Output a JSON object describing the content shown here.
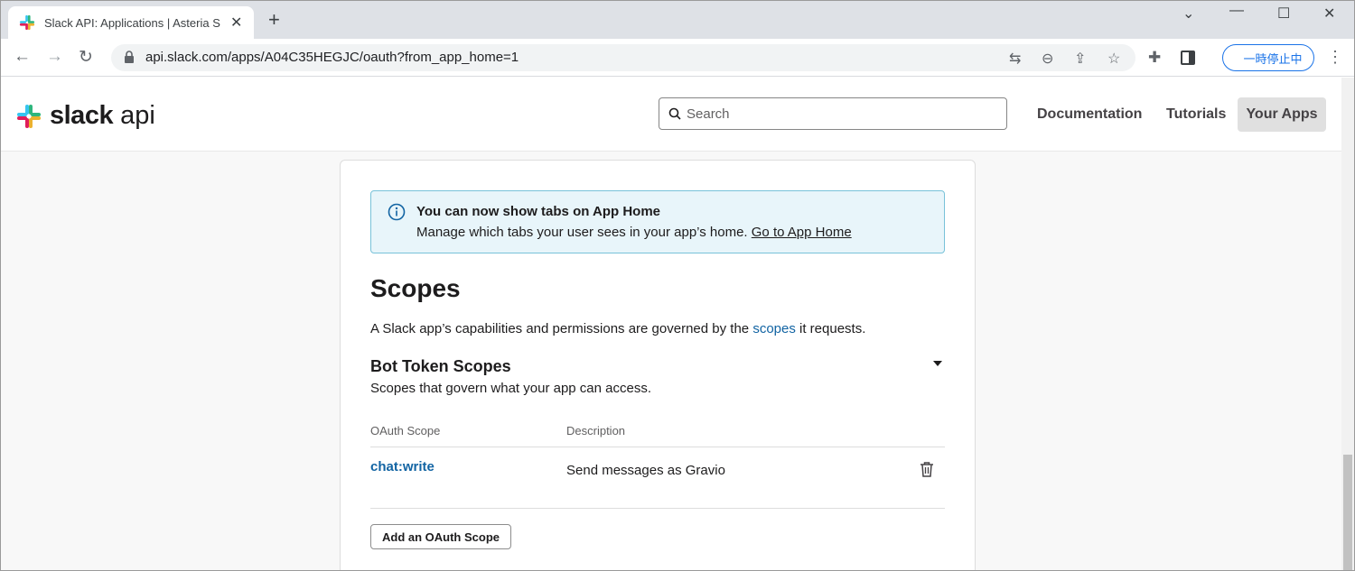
{
  "browser": {
    "tab_title": "Slack API: Applications | Asteria S",
    "url": "api.slack.com/apps/A04C35HEGJC/oauth?from_app_home=1",
    "paused_label": "一時停止中"
  },
  "header": {
    "logo_text": "slack",
    "logo_api": "api",
    "search_placeholder": "Search",
    "nav": {
      "documentation": "Documentation",
      "tutorials": "Tutorials",
      "your_apps": "Your Apps"
    }
  },
  "banner": {
    "title": "You can now show tabs on App Home",
    "body": "Manage which tabs your user sees in your app’s home. ",
    "link": "Go to App Home"
  },
  "scopes": {
    "heading": "Scopes",
    "intro_before": "A Slack app’s capabilities and permissions are governed by the ",
    "intro_link": "scopes",
    "intro_after": " it requests.",
    "bot_heading": "Bot Token Scopes",
    "bot_sub": "Scopes that govern what your app can access.",
    "table": {
      "col_scope": "OAuth Scope",
      "col_description": "Description",
      "rows": [
        {
          "scope": "chat:write",
          "description": "Send messages as Gravio"
        }
      ]
    },
    "add_button": "Add an OAuth Scope"
  },
  "colors": {
    "link": "#1264a3",
    "banner_bg": "#e8f5fa",
    "banner_border": "#78c2d9",
    "chrome_blue": "#1a73e8"
  },
  "icons": {
    "tab_close": "close-icon",
    "new_tab": "plus-icon",
    "back": "arrow-left-icon",
    "forward": "arrow-right-icon",
    "reload": "reload-icon",
    "lock": "lock-icon",
    "translate": "translate-icon",
    "zoom": "zoom-out-icon",
    "share": "share-icon",
    "bookmark": "star-icon",
    "extensions": "puzzle-icon",
    "sidepanel": "side-panel-icon",
    "menu": "kebab-menu-icon",
    "search": "search-icon",
    "info": "info-icon",
    "caret": "caret-down-icon",
    "trash": "trash-icon"
  }
}
